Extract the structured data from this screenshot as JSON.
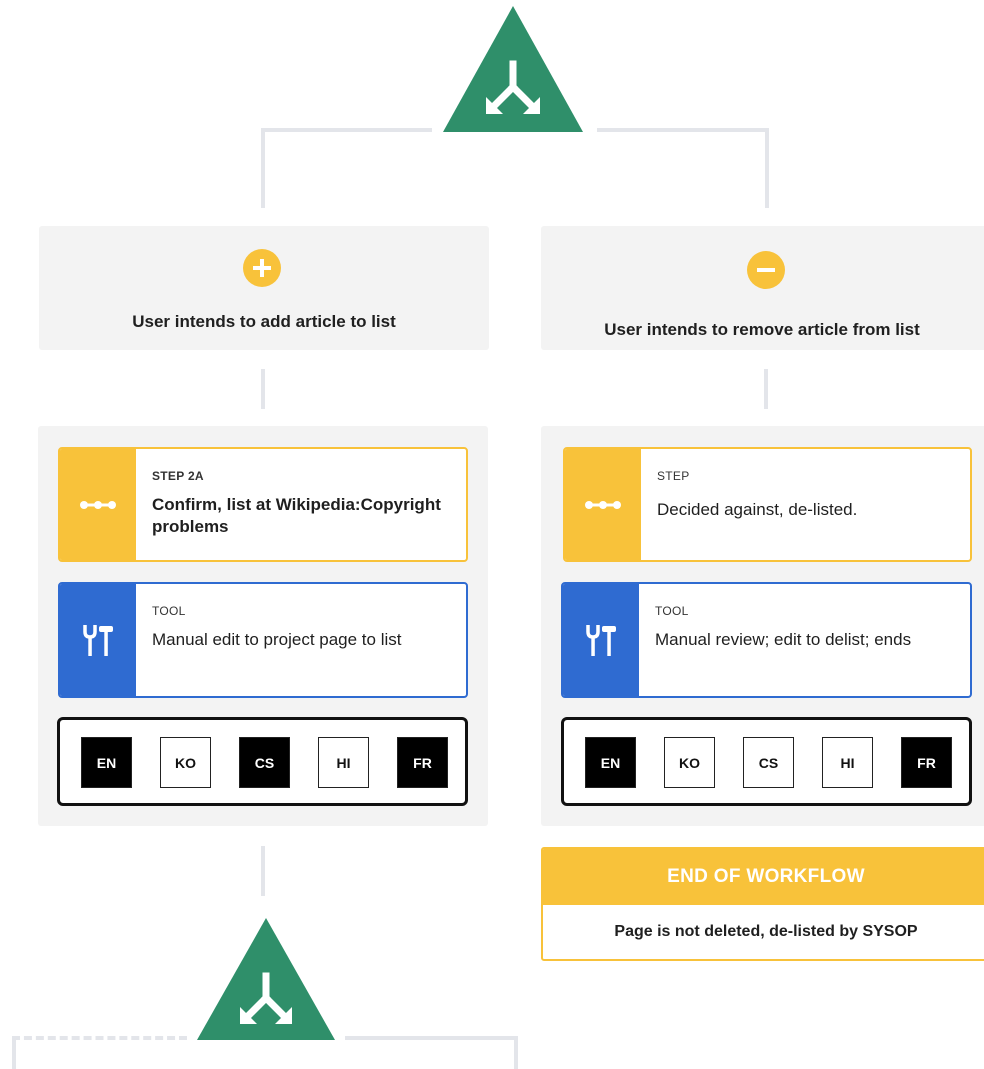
{
  "colors": {
    "accent_green": "#2f8f6a",
    "step_yellow": "#f8c23a",
    "tool_blue": "#2f6bd1",
    "panel_gray": "#f3f3f3",
    "connector_gray": "#e3e5ea"
  },
  "icons": {
    "split": "split-arrows-icon",
    "plus": "plus-icon",
    "minus": "minus-icon",
    "step": "dots-icon",
    "tool": "tools-icon"
  },
  "branches": [
    {
      "intent": "User intends to add article to list",
      "step_caption": "STEP 2A",
      "step_text": "Confirm, list at Wikipedia:Copyright problems",
      "tool_caption": "TOOL",
      "tool_text": "Manual edit to project page to list",
      "languages": [
        "EN",
        "KO",
        "CS",
        "HI",
        "FR"
      ]
    },
    {
      "intent": "User intends to remove article from list",
      "step_caption": "STEP",
      "step_text": "Decided against, de-listed.",
      "tool_caption": "TOOL",
      "tool_text": "Manual review; edit to delist; ends",
      "languages": [
        "EN",
        "KO",
        "CS",
        "HI",
        "FR"
      ]
    }
  ],
  "end": {
    "title": "END OF WORKFLOW",
    "text": "Page is not deleted, de-listed by SYSOP"
  }
}
